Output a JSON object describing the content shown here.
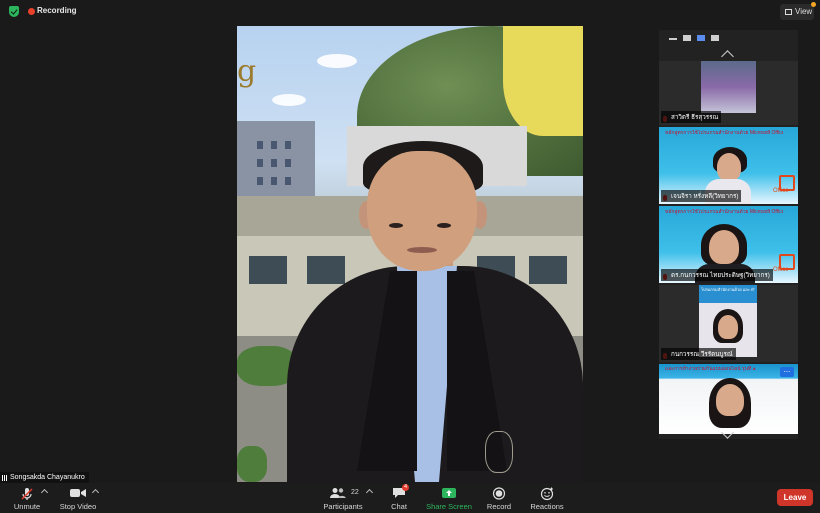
{
  "top": {
    "recording_label": "Recording",
    "view_label": "View"
  },
  "speaker": {
    "name": "Songsakda Chayanukro"
  },
  "gallery": {
    "tiles": [
      {
        "name": "สาวิตรี ธีรสุวรรณ"
      },
      {
        "name": "เจนจิรา หรั่งหลี(วิทยากร)",
        "slide_title": "หลักสูตรการใช้โปรแกรมสำนักงานด้วย Microsoft Office และการทำงานร่วมกันแบบออนไลน์ รุ่นที่ ๑"
      },
      {
        "name": "ดร.กนกวรรณ ไทยประดิษฐ(วิทยากร)",
        "slide_title": "หลักสูตรการใช้โปรแกรมสำนักงานด้วย Microsoft Office และการทำงานร่วมกันแบบออนไลน์ รุ่นที่ ๑"
      },
      {
        "name": "กนกวรรณ วีรรัตนบูรณ์",
        "slide_title": "โปรแกรมสำนักงานด้วย และ ทำงานร่วมกันแบบออนไลน์"
      },
      {
        "name": "",
        "slide_title": "และการทำงานร่วมกันแบบออนไลน์ รุ่นที่ ๑"
      }
    ],
    "office_text": "Office",
    "more_label": "..."
  },
  "toolbar": {
    "unmute": "Unmute",
    "stop_video": "Stop Video",
    "participants": "Participants",
    "participants_count": "22",
    "chat": "Chat",
    "chat_badge": "4",
    "share_screen": "Share Screen",
    "record": "Record",
    "reactions": "Reactions",
    "leave": "Leave"
  },
  "colors": {
    "share_green": "#2db55d",
    "leave_red": "#d0352a",
    "recording_red": "#e8412c"
  }
}
